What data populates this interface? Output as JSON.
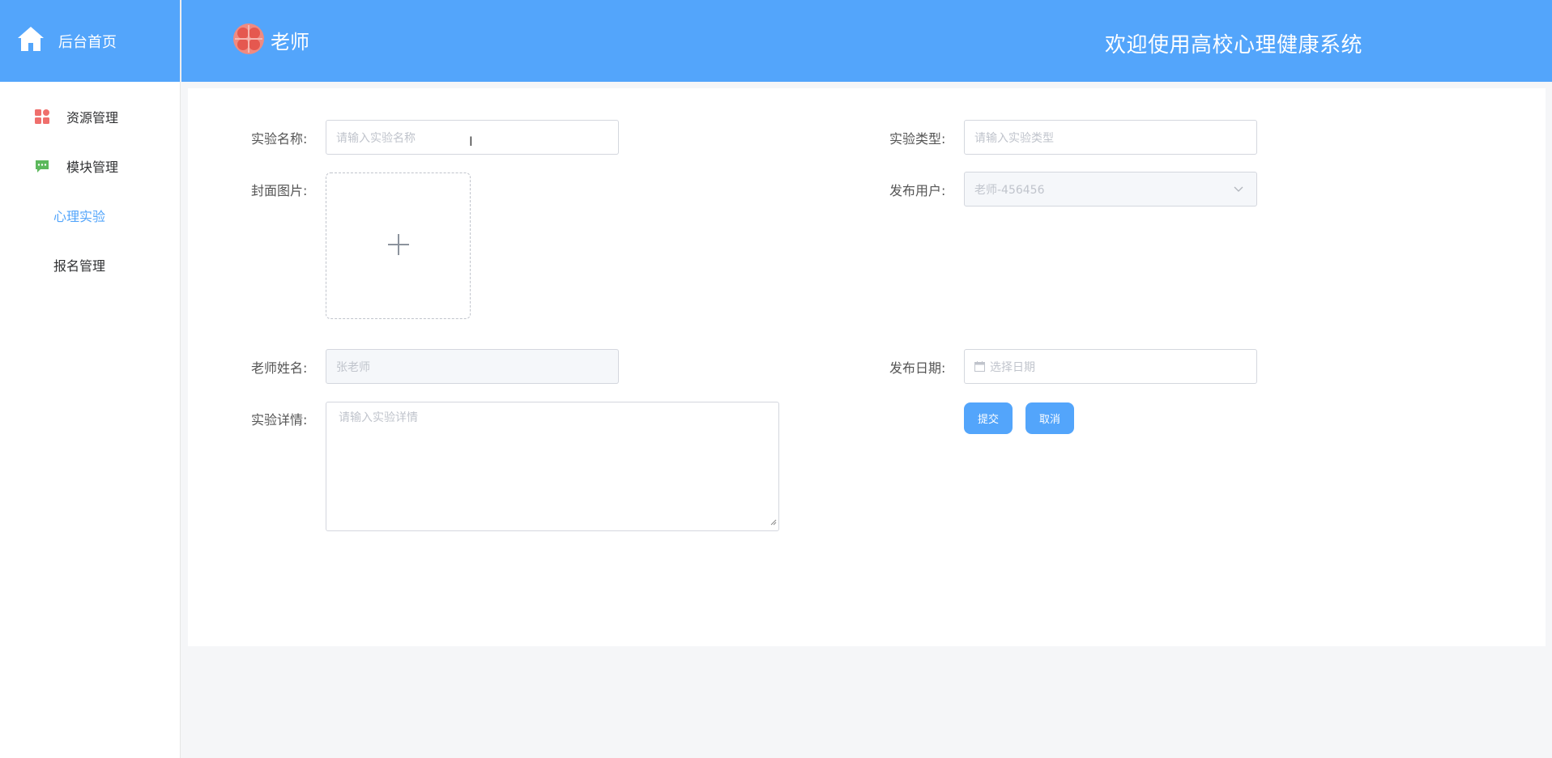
{
  "sidebar": {
    "home_label": "后台首页",
    "items": [
      {
        "label": "资源管理",
        "icon": "grid-icon",
        "color": "#ef6f6c"
      },
      {
        "label": "模块管理",
        "icon": "chat-icon",
        "color": "#5cb85c"
      },
      {
        "label": "心理实验",
        "active": true
      },
      {
        "label": "报名管理"
      }
    ]
  },
  "header": {
    "role": "老师",
    "welcome": "欢迎使用高校心理健康系统",
    "bg_color": "#53a5fb"
  },
  "form": {
    "name_label": "实验名称:",
    "name_placeholder": "请输入实验名称",
    "type_label": "实验类型:",
    "type_placeholder": "请输入实验类型",
    "cover_label": "封面图片:",
    "publisher_label": "发布用户:",
    "publisher_value": "老师-456456",
    "teacher_label": "老师姓名:",
    "teacher_value": "张老师",
    "date_label": "发布日期:",
    "date_placeholder": "选择日期",
    "detail_label": "实验详情:",
    "detail_placeholder": "请输入实验详情",
    "submit_label": "提交",
    "cancel_label": "取消"
  }
}
